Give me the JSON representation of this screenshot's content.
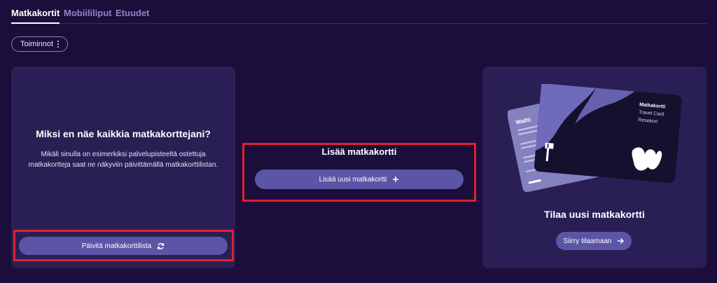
{
  "tabs": [
    {
      "label": "Matkakortit",
      "active": true
    },
    {
      "label": "Mobiililiput",
      "active": false
    },
    {
      "label": "Etuudet",
      "active": false
    }
  ],
  "actions": {
    "label": "Toiminnot",
    "icon": "more-vertical-icon"
  },
  "left_card": {
    "title": "Miksi en näe kaikkia matkakorttejani?",
    "text": "Mikäli sinulla on esimerkiksi palvelupisteeltä ostettuja matkakortteja saat ne näkyviin päivittämällä matkakorttilistan.",
    "button_label": "Päivitä matkakorttilista",
    "button_icon": "refresh-icon"
  },
  "middle": {
    "title": "Lisää matkakortti",
    "button_label": "Lisää uusi matkakortti",
    "button_icon": "plus-icon"
  },
  "right_card": {
    "card_front_lines": [
      "Matkakortti",
      "Travel Card",
      "Resekort"
    ],
    "card_back_title": "Waltti",
    "title": "Tilaa uusi matkakortti",
    "button_label": "Siirry tilaamaan",
    "button_icon": "arrow-right-icon"
  },
  "colors": {
    "background": "#1b0e3a",
    "card": "#2a1f55",
    "button": "#5c55a6",
    "highlight": "#e0202f"
  }
}
